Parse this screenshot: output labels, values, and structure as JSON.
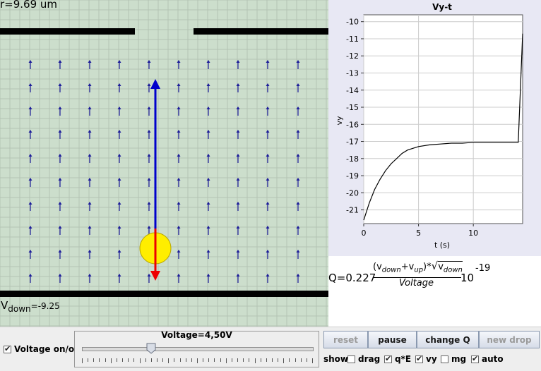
{
  "simulation": {
    "radius_text": "r=9.69 um",
    "vdown_main": "V",
    "vdown_sub": "down",
    "vdown_value": "=-9.25"
  },
  "chart_data": {
    "type": "line",
    "title": "Vy-t",
    "xlabel": "t (s)",
    "ylabel": "vy",
    "xlim": [
      0,
      14.5
    ],
    "ylim": [
      -21.8,
      -9.6
    ],
    "xticks": [
      0,
      5,
      10
    ],
    "yticks": [
      -10,
      -11,
      -12,
      -13,
      -14,
      -15,
      -16,
      -17,
      -18,
      -19,
      -20,
      -21
    ],
    "grid": true,
    "series": [
      {
        "x": [
          0,
          0.5,
          1,
          1.5,
          2,
          2.5,
          3,
          3.5,
          4,
          5,
          6,
          7,
          8,
          9,
          10,
          11,
          12,
          13,
          14.1,
          14.1,
          14.5
        ],
        "y": [
          -21.6,
          -20.6,
          -19.8,
          -19.2,
          -18.7,
          -18.3,
          -18.0,
          -17.7,
          -17.5,
          -17.3,
          -17.2,
          -17.15,
          -17.1,
          -17.1,
          -17.05,
          -17.05,
          -17.05,
          -17.05,
          -17.05,
          -17.05,
          -10.7
        ],
        "color": "#000000"
      }
    ]
  },
  "formula": {
    "lhs": "Q=0.227",
    "num_v1": "v",
    "num_sub1": "down",
    "num_plus": "+v",
    "num_sub2": "up",
    "num_close": ")*",
    "sqrt_v": "v",
    "sqrt_sub": "down",
    "denominator": "Voltage",
    "base": "10",
    "exponent": "-19"
  },
  "controls": {
    "voltage_toggle_label": "Voltage on/off",
    "voltage_toggle_checked": true,
    "slider_label": "Voltage=4,50V",
    "slider_fraction": 0.3,
    "buttons": {
      "reset": "reset",
      "pause": "pause",
      "change_q": "change Q",
      "new_drop": "new drop"
    },
    "show_label": "show",
    "options": {
      "drag": "drag",
      "qe": "q*E",
      "vy": "vy",
      "mg": "mg",
      "auto": "auto"
    },
    "checked": {
      "drag": false,
      "qe": true,
      "vy": true,
      "mg": false,
      "auto": true
    }
  },
  "colors": {
    "sim_bg": "#ccdecc",
    "grid": "#b4c4b4",
    "field_arrow": "#1b1b9a",
    "qe_arrow": "#0000cc",
    "mg_arrow": "#ee0000",
    "drop": "#ffee00"
  }
}
